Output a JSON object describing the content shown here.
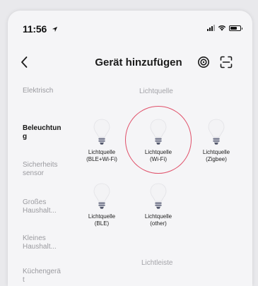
{
  "status_bar": {
    "time": "11:56"
  },
  "nav": {
    "title": "Gerät hinzufügen"
  },
  "sidebar": {
    "items": [
      {
        "label": "Elektrisch",
        "active": false
      },
      {
        "label": "Beleuchtun\ng",
        "active": true
      },
      {
        "label": "Sicherheits\nsensor",
        "active": false
      },
      {
        "label": "Großes\nHaushalt...",
        "active": false
      },
      {
        "label": "Kleines\nHaushalt...",
        "active": false
      },
      {
        "label": "Küchengerä\nt",
        "active": false
      }
    ]
  },
  "sections": {
    "light_source": "Lichtquelle",
    "light_strip": "Lichtleiste"
  },
  "devices": [
    {
      "line1": "Lichtquelle",
      "line2": "(BLE+Wi-Fi)"
    },
    {
      "line1": "Lichtquelle",
      "line2": "(Wi-Fi)",
      "selected": true
    },
    {
      "line1": "Lichtquelle",
      "line2": "(Zigbee)"
    },
    {
      "line1": "Lichtquelle",
      "line2": "(BLE)"
    },
    {
      "line1": "Lichtquelle",
      "line2": "(other)"
    }
  ],
  "colors": {
    "selection_ring": "#e05069",
    "active_category": "#151515",
    "inactive_category": "#9a9a9f"
  }
}
